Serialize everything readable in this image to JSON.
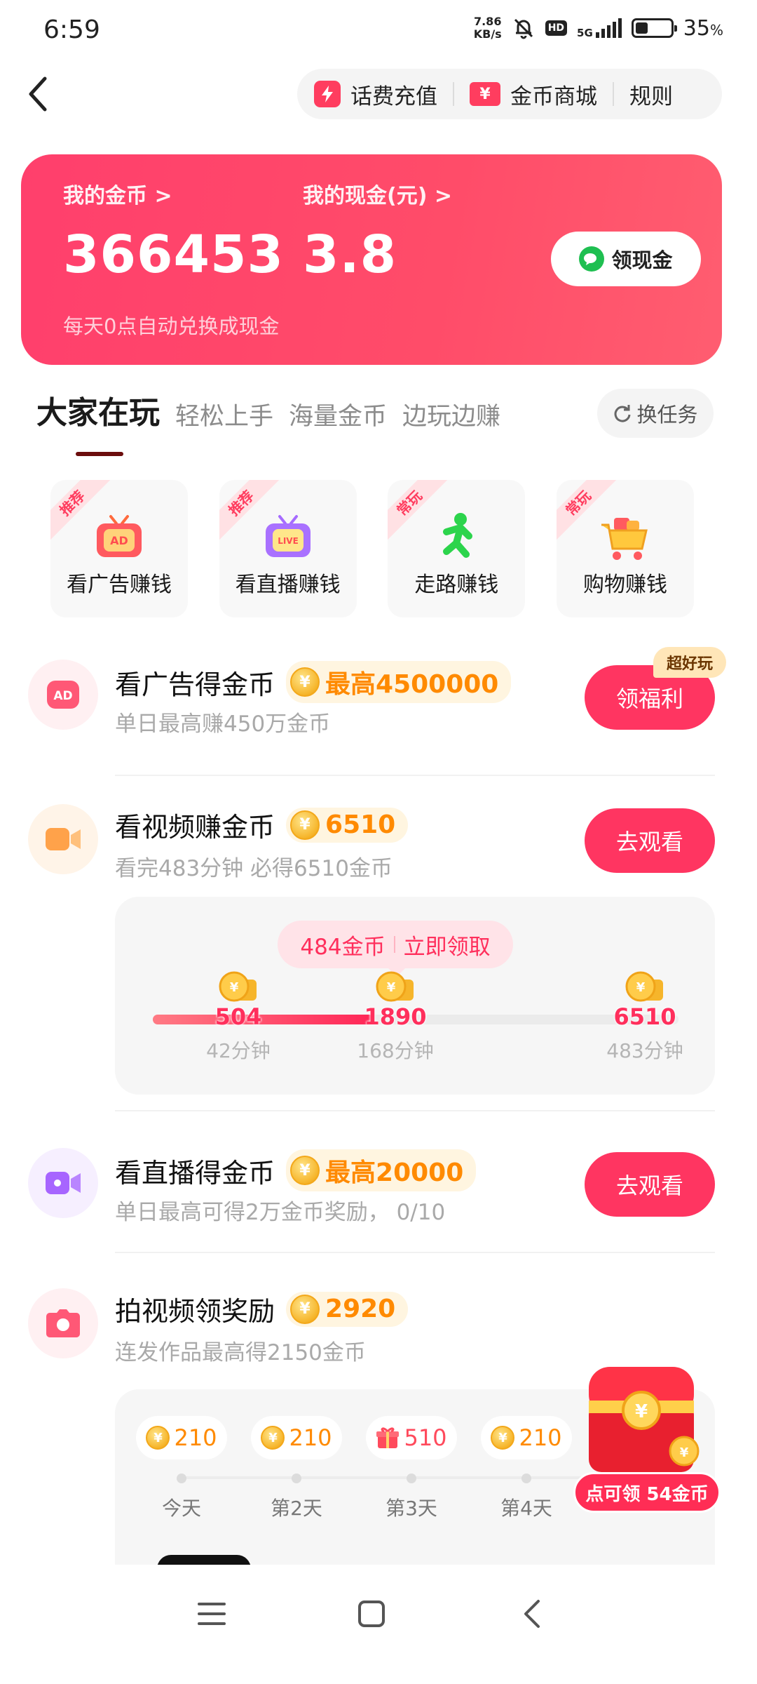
{
  "status": {
    "time": "6:59",
    "net_speed_value": "7.86",
    "net_speed_unit": "KB/s",
    "hd": "HD",
    "network": "5G",
    "battery": "35",
    "battery_unit": "%",
    "battery_level": 0.35
  },
  "topbar": {
    "recharge": "话费充值",
    "mall": "金币商城",
    "rules": "规则"
  },
  "wallet": {
    "coins_label": "我的金币 >",
    "coins_value": "366453",
    "cash_label": "我的现金(元) >",
    "cash_value": "3.8",
    "claim_button": "领现金",
    "note": "每天0点自动兑换成现金"
  },
  "tabs": {
    "items": [
      "大家在玩",
      "轻松上手",
      "海量金币",
      "边玩边赚"
    ],
    "switch": "换任务"
  },
  "quick": [
    {
      "tag": "推荐",
      "label": "看广告赚钱",
      "icon": "ad-tv-icon"
    },
    {
      "tag": "推荐",
      "label": "看直播赚钱",
      "icon": "live-tv-icon"
    },
    {
      "tag": "常玩",
      "label": "走路赚钱",
      "icon": "walking-figure-icon"
    },
    {
      "tag": "常玩",
      "label": "购物赚钱",
      "icon": "shopping-cart-icon"
    }
  ],
  "tasks": {
    "ad": {
      "title": "看广告得金币",
      "reward": "最高4500000",
      "sub": "单日最高赚450万金币",
      "button": "领福利",
      "badge": "超好玩"
    },
    "video": {
      "title": "看视频赚金币",
      "reward": "6510",
      "sub": "看完483分钟 必得6510金币",
      "button": "去观看",
      "bubble_coins": "484金币",
      "bubble_action": "立即领取",
      "progress": 0.42,
      "milestones": [
        {
          "value": "504",
          "minutes": "42分钟"
        },
        {
          "value": "1890",
          "minutes": "168分钟"
        },
        {
          "value": "6510",
          "minutes": "483分钟"
        }
      ]
    },
    "live": {
      "title": "看直播得金币",
      "reward": "最高20000",
      "sub": "单日最高可得2万金币奖励， 0/10",
      "button": "去观看"
    },
    "shoot": {
      "title": "拍视频领奖励",
      "reward": "2920",
      "sub": "连发作品最高得2150金币",
      "days": [
        {
          "amount": "210",
          "label": "今天",
          "icon": "coin-icon"
        },
        {
          "amount": "210",
          "label": "第2天",
          "icon": "coin-icon"
        },
        {
          "amount": "510",
          "label": "第3天",
          "icon": "gift-icon"
        },
        {
          "amount": "210",
          "label": "第4天",
          "icon": "coin-icon"
        }
      ],
      "chest_button": "点可领 54金币"
    }
  },
  "colors": {
    "accent": "#ff3561",
    "coin": "#ff8a00",
    "card": "#ff4c69"
  }
}
